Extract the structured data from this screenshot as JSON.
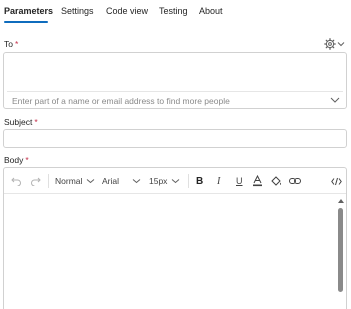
{
  "tabs": [
    {
      "label": "Parameters",
      "active": true
    },
    {
      "label": "Settings"
    },
    {
      "label": "Code view"
    },
    {
      "label": "Testing"
    },
    {
      "label": "About"
    }
  ],
  "to": {
    "label": "To",
    "required_mark": "*",
    "placeholder": "Enter part of a name or email address to find more people",
    "value": ""
  },
  "subject": {
    "label": "Subject",
    "required_mark": "*",
    "value": ""
  },
  "body": {
    "label": "Body",
    "required_mark": "*",
    "toolbar": {
      "format": "Normal",
      "font": "Arial",
      "size": "15px",
      "bold": "B",
      "italic": "I",
      "underline": "U"
    }
  },
  "colors": {
    "accent": "#0f6cbd",
    "required": "#c4314b",
    "border": "#d1d1d1",
    "text": "#242424",
    "placeholder": "#8a8a8a"
  },
  "icons": [
    "gear-icon",
    "chevron-down-icon",
    "undo-icon",
    "redo-icon",
    "font-color-icon",
    "highlight-icon",
    "link-icon",
    "code-view-icon",
    "scroll-up-icon"
  ]
}
